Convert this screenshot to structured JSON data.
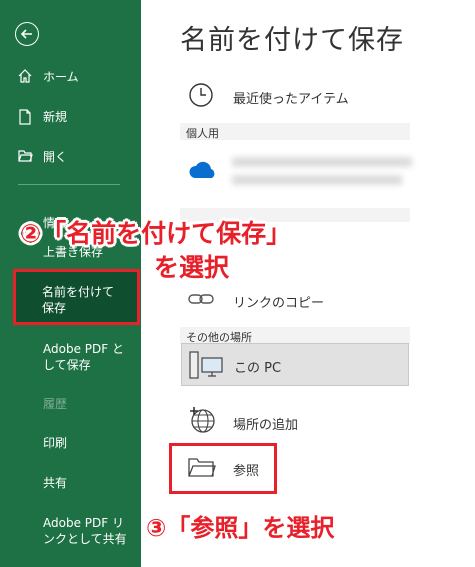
{
  "sidebar": {
    "home": "ホーム",
    "new": "新規",
    "open": "開く",
    "info": "情報",
    "overwrite": "上書き保存",
    "save_as": "名前を付けて保存",
    "pdf_save": "Adobe PDF として保存",
    "history": "履歴",
    "print": "印刷",
    "share": "共有",
    "pdf_share": "Adobe PDF リンクとして共有"
  },
  "main": {
    "title": "名前を付けて保存",
    "recent": "最近使ったアイテム",
    "personal_header": "個人用",
    "link_copy": "リンクのコピー",
    "other_header": "その他の場所",
    "this_pc": "この PC",
    "add_place": "場所の追加",
    "browse": "参照"
  },
  "annotations": {
    "step2_line1": "②「名前を付けて保存」",
    "step2_line2": "を選択",
    "step3": "③「参照」を選択"
  },
  "colors": {
    "sidebar_bg": "#1e7145",
    "selected_bg": "#0f4e2e",
    "annotation_red": "#e8202a"
  }
}
